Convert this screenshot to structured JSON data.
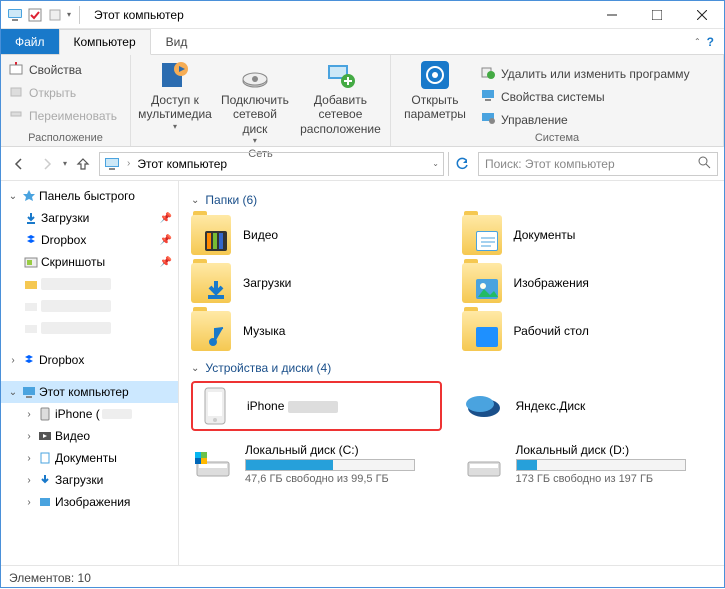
{
  "window": {
    "title": "Этот компьютер"
  },
  "tabs": {
    "file": "Файл",
    "computer": "Компьютер",
    "view": "Вид"
  },
  "ribbon": {
    "group_location": {
      "properties": "Свойства",
      "open": "Открыть",
      "rename": "Переименовать",
      "label": "Расположение"
    },
    "group_network": {
      "media": "Доступ к мультимедиа",
      "map_drive": "Подключить сетевой диск",
      "add_location": "Добавить сетевое расположение",
      "label": "Сеть"
    },
    "group_system": {
      "open_settings": "Открыть параметры",
      "uninstall": "Удалить или изменить программу",
      "sys_props": "Свойства системы",
      "manage": "Управление",
      "label": "Система"
    }
  },
  "nav": {
    "breadcrumb": "Этот компьютер",
    "search_placeholder": "Поиск: Этот компьютер"
  },
  "sidebar": {
    "quick_access": "Панель быстрого",
    "downloads": "Загрузки",
    "dropbox": "Dropbox",
    "screenshots": "Скриншоты",
    "dropbox2": "Dropbox",
    "this_pc": "Этот компьютер",
    "iphone": "iPhone (",
    "videos": "Видео",
    "documents": "Документы",
    "downloads2": "Загрузки",
    "images": "Изображения"
  },
  "content": {
    "folders_header": "Папки (6)",
    "folders": {
      "videos": "Видео",
      "documents": "Документы",
      "downloads": "Загрузки",
      "images": "Изображения",
      "music": "Музыка",
      "desktop": "Рабочий стол"
    },
    "drives_header": "Устройства и диски (4)",
    "iphone_label": "iPhone",
    "yandex_label": "Яндекс.Диск",
    "drive_c": {
      "label": "Локальный диск (C:)",
      "sub": "47,6 ГБ свободно из 99,5 ГБ",
      "used_pct": 52
    },
    "drive_d": {
      "label": "Локальный диск (D:)",
      "sub": "173 ГБ свободно из 197 ГБ",
      "used_pct": 12
    }
  },
  "statusbar": {
    "elements": "Элементов: 10"
  }
}
